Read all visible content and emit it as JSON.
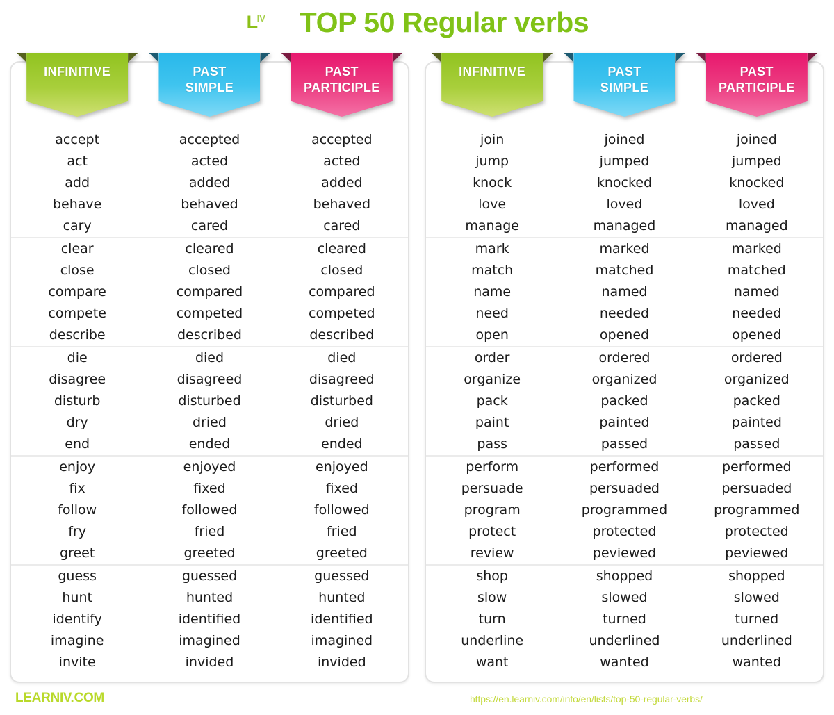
{
  "header": {
    "logo_l": "L",
    "logo_iv": "IV",
    "title": "TOP 50 Regular verbs"
  },
  "colors": {
    "title_green": "#80c217",
    "banner_green": "#91c320",
    "banner_blue": "#29b8ea",
    "banner_pink": "#e8186e",
    "footer_green": "#b9d92a",
    "card_border": "#e2e2e2"
  },
  "columns": [
    {
      "id": "infinitive",
      "label_lines": [
        "INFINITIVE"
      ],
      "color": "green"
    },
    {
      "id": "past_simple",
      "label_lines": [
        "PAST",
        "SIMPLE"
      ],
      "color": "blue"
    },
    {
      "id": "past_participle",
      "label_lines": [
        "PAST",
        "PARTICIPLE"
      ],
      "color": "pink"
    }
  ],
  "tables": [
    {
      "id": "left-table",
      "groups": [
        [
          [
            "accept",
            "accepted",
            "accepted"
          ],
          [
            "act",
            "acted",
            "acted"
          ],
          [
            "add",
            "added",
            "added"
          ],
          [
            "behave",
            "behaved",
            "behaved"
          ],
          [
            "cary",
            "cared",
            "cared"
          ]
        ],
        [
          [
            "clear",
            "cleared",
            "cleared"
          ],
          [
            "close",
            "closed",
            "closed"
          ],
          [
            "compare",
            "compared",
            "compared"
          ],
          [
            "compete",
            "competed",
            "competed"
          ],
          [
            "describe",
            "described",
            "described"
          ]
        ],
        [
          [
            "die",
            "died",
            "died"
          ],
          [
            "disagree",
            "disagreed",
            "disagreed"
          ],
          [
            "disturb",
            "disturbed",
            "disturbed"
          ],
          [
            "dry",
            "dried",
            "dried"
          ],
          [
            "end",
            "ended",
            "ended"
          ]
        ],
        [
          [
            "enjoy",
            "enjoyed",
            "enjoyed"
          ],
          [
            "fix",
            "fixed",
            "fixed"
          ],
          [
            "follow",
            "followed",
            "followed"
          ],
          [
            "fry",
            "fried",
            "fried"
          ],
          [
            "greet",
            "greeted",
            "greeted"
          ]
        ],
        [
          [
            "guess",
            "guessed",
            "guessed"
          ],
          [
            "hunt",
            "hunted",
            "hunted"
          ],
          [
            "identify",
            "identified",
            "identified"
          ],
          [
            "imagine",
            "imagined",
            "imagined"
          ],
          [
            "invite",
            "invided",
            "invided"
          ]
        ]
      ]
    },
    {
      "id": "right-table",
      "groups": [
        [
          [
            "join",
            "joined",
            "joined"
          ],
          [
            "jump",
            "jumped",
            "jumped"
          ],
          [
            "knock",
            "knocked",
            "knocked"
          ],
          [
            "love",
            "loved",
            "loved"
          ],
          [
            "manage",
            "managed",
            "managed"
          ]
        ],
        [
          [
            "mark",
            "marked",
            "marked"
          ],
          [
            "match",
            "matched",
            "matched"
          ],
          [
            "name",
            "named",
            "named"
          ],
          [
            "need",
            "needed",
            "needed"
          ],
          [
            "open",
            "opened",
            "opened"
          ]
        ],
        [
          [
            "order",
            "ordered",
            "ordered"
          ],
          [
            "organize",
            "organized",
            "organized"
          ],
          [
            "pack",
            "packed",
            "packed"
          ],
          [
            "paint",
            "painted",
            "painted"
          ],
          [
            "pass",
            "passed",
            "passed"
          ]
        ],
        [
          [
            "perform",
            "performed",
            "performed"
          ],
          [
            "persuade",
            "persuaded",
            "persuaded"
          ],
          [
            "program",
            "programmed",
            "programmed"
          ],
          [
            "protect",
            "protected",
            "protected"
          ],
          [
            "review",
            "peviewed",
            "peviewed"
          ]
        ],
        [
          [
            "shop",
            "shopped",
            "shopped"
          ],
          [
            "slow",
            "slowed",
            "slowed"
          ],
          [
            "turn",
            "turned",
            "turned"
          ],
          [
            "underline",
            "underlined",
            "underlined"
          ],
          [
            "want",
            "wanted",
            "wanted"
          ]
        ]
      ]
    }
  ],
  "footer": {
    "brand": "LEARNIV.COM",
    "url": "https://en.learniv.com/info/en/lists/top-50-regular-verbs/"
  }
}
